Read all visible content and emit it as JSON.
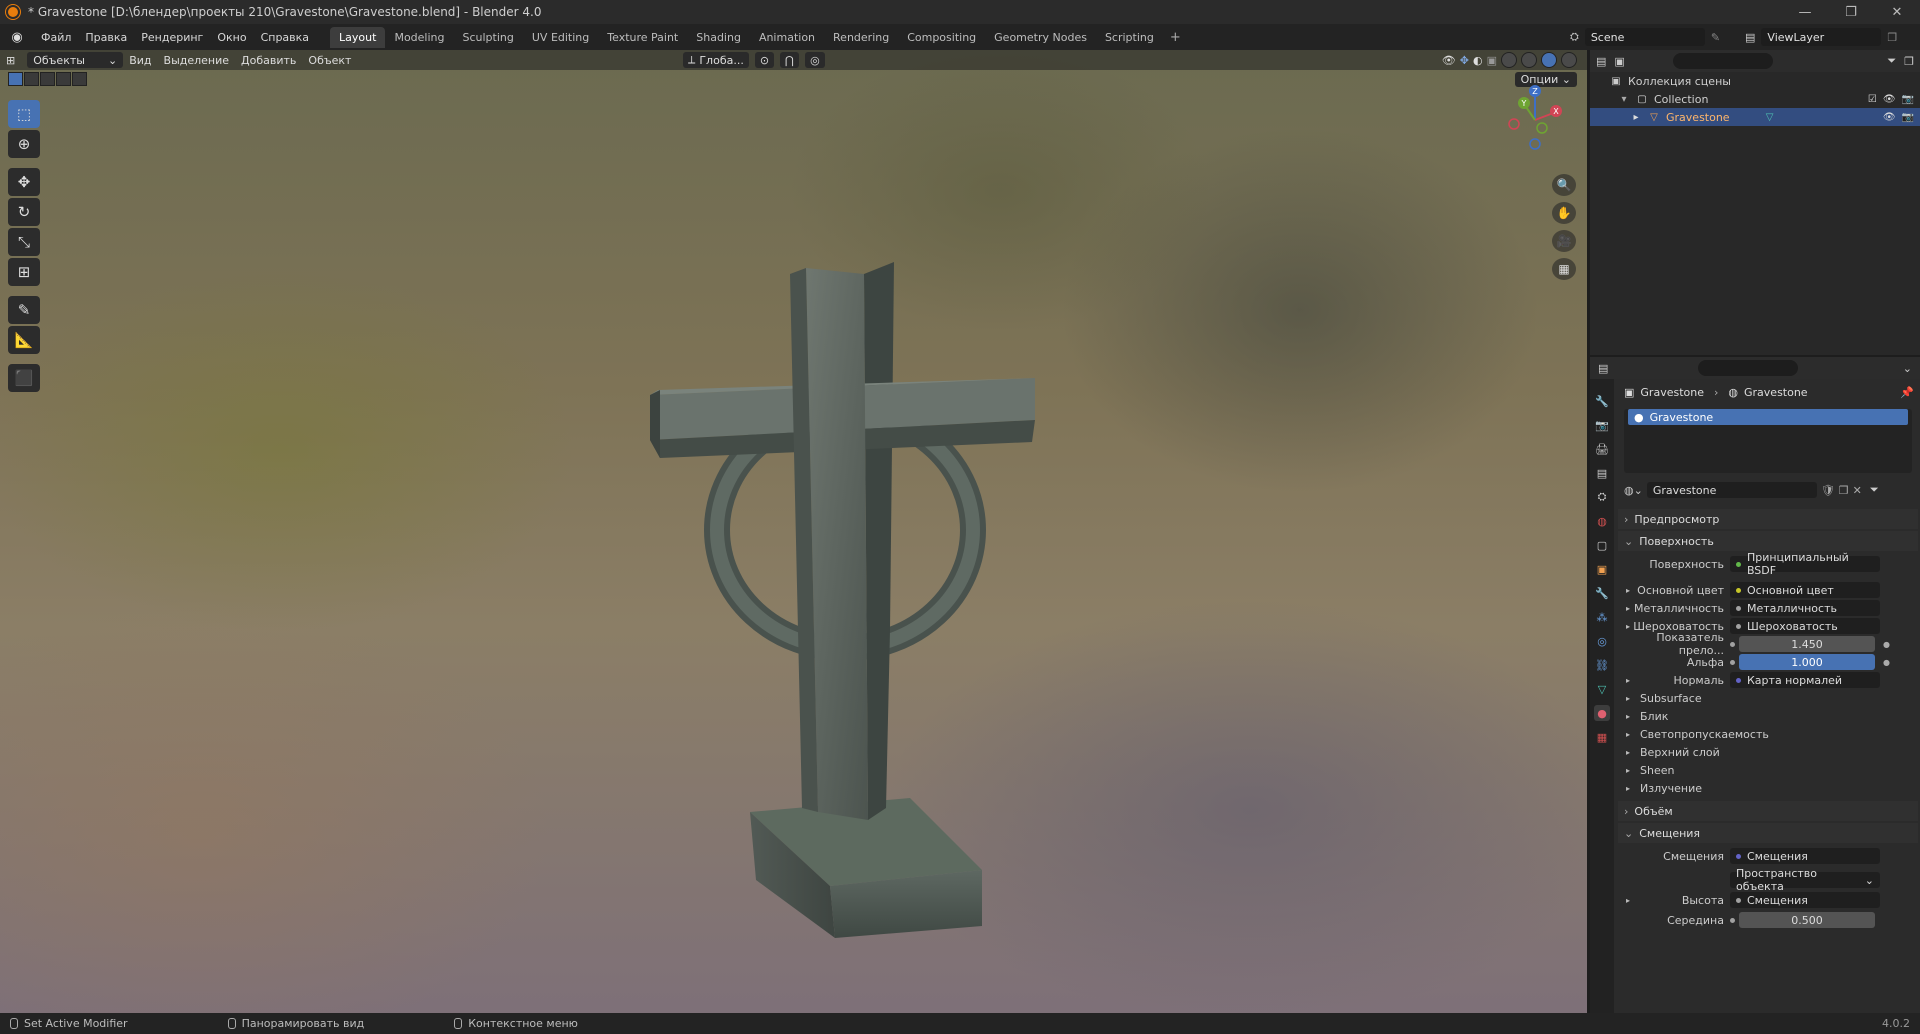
{
  "titlebar": {
    "title": "* Gravestone [D:\\блендер\\проекты 210\\Gravestone\\Gravestone.blend] - Blender 4.0",
    "minimize": "—",
    "maximize": "❐",
    "close": "✕"
  },
  "menu": {
    "items": [
      "Файл",
      "Правка",
      "Рендеринг",
      "Окно",
      "Справка"
    ]
  },
  "workspaces": {
    "tabs": [
      "Layout",
      "Modeling",
      "Sculpting",
      "UV Editing",
      "Texture Paint",
      "Shading",
      "Animation",
      "Rendering",
      "Compositing",
      "Geometry Nodes",
      "Scripting"
    ],
    "active": "Layout",
    "add": "+"
  },
  "scene": {
    "name": "Scene"
  },
  "view_layer": {
    "name": "ViewLayer"
  },
  "viewport": {
    "mode": "Объекты",
    "menus": [
      "Вид",
      "Выделение",
      "Добавить",
      "Объект"
    ],
    "orientation": "Глоба...",
    "options": "Опции",
    "gizmo_axes": {
      "x": "X",
      "y": "Y",
      "z": "Z"
    }
  },
  "outliner": {
    "scene_collection": "Коллекция сцены",
    "collection": "Collection",
    "object": "Gravestone"
  },
  "properties": {
    "breadcrumb_object": "Gravestone",
    "breadcrumb_material": "Gravestone",
    "slot": "Gravestone",
    "material_name": "Gravestone",
    "panels": {
      "preview": "Предпросмотр",
      "surface": "Поверхность",
      "volume": "Объём",
      "displacement": "Смещения"
    },
    "surface_rows": [
      {
        "label": "Поверхность",
        "value": "Принципиальный BSDF",
        "dot": "#62b84a"
      },
      {
        "label": "Основной цвет",
        "value": "Основной цвет",
        "dot": "#c7c729"
      },
      {
        "label": "Металличность",
        "value": "Металличность",
        "dot": "#a1a1a1"
      },
      {
        "label": "Шероховатость",
        "value": "Шероховатость",
        "dot": "#a1a1a1"
      }
    ],
    "ior": {
      "label": "Показатель прело...",
      "value": "1.450"
    },
    "alpha": {
      "label": "Альфа",
      "value": "1.000"
    },
    "normal": {
      "label": "Нормаль",
      "value": "Карта нормалей"
    },
    "subpanels": [
      "Subsurface",
      "Блик",
      "Светопропускаемость",
      "Верхний слой",
      "Sheen",
      "Излучение"
    ],
    "displacement_rows": {
      "label": "Смещения",
      "value": "Смещения",
      "space": "Пространство объекта",
      "height_label": "Высота",
      "height_value": "Смещения",
      "midlevel_label": "Середина",
      "midlevel_value": "0.500"
    }
  },
  "statusbar": {
    "left": "Set Active Modifier",
    "middle": "Панорамировать вид",
    "right": "Контекстное меню",
    "version": "4.0.2"
  }
}
